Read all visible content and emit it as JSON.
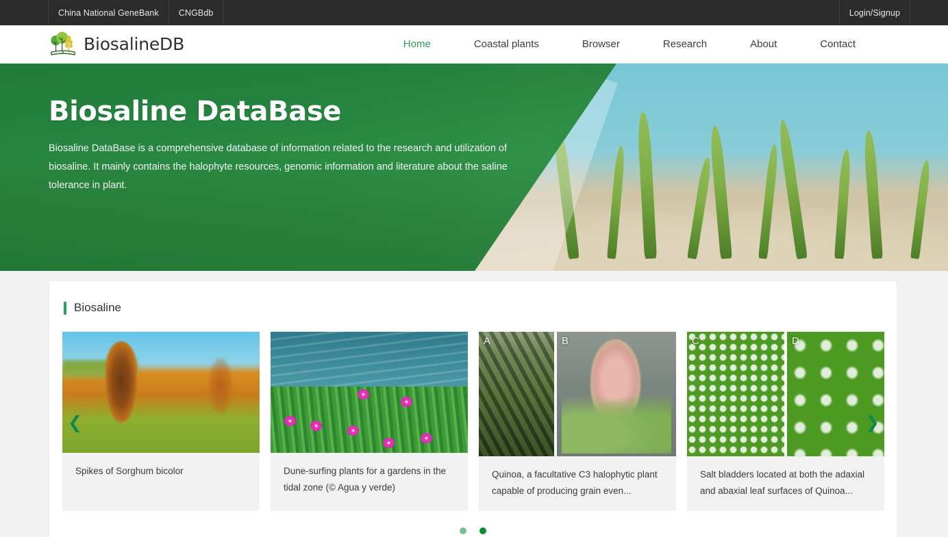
{
  "topbar": {
    "items": [
      {
        "label": "China National GeneBank"
      },
      {
        "label": "CNGBdb"
      }
    ],
    "login": "Login/Signup"
  },
  "header": {
    "brand": "BiosalineDB",
    "logo_icon": "tree-book-logo-icon",
    "nav": [
      {
        "label": "Home",
        "active": true
      },
      {
        "label": "Coastal plants",
        "active": false
      },
      {
        "label": "Browser",
        "active": false
      },
      {
        "label": "Research",
        "active": false
      },
      {
        "label": "About",
        "active": false
      },
      {
        "label": "Contact",
        "active": false
      }
    ]
  },
  "hero": {
    "title": "Biosaline DataBase",
    "description": "Biosaline DataBase is a comprehensive database of information related to the research and utilization of biosaline. It mainly contains the halophyte resources, genomic information and literature about the saline tolerance in plant."
  },
  "section": {
    "title": "Biosaline",
    "accent_color": "#2aa356"
  },
  "carousel": {
    "prev_icon": "chevron-left-icon",
    "next_icon": "chevron-right-icon",
    "cards": [
      {
        "image_alt": "sorghum-field-photo",
        "caption": "Spikes of Sorghum bicolor",
        "panel_labels": []
      },
      {
        "image_alt": "ice-plant-coastal-photo",
        "caption": "Dune-surfing plants for a gardens in the tidal zone (© Agua y verde)",
        "panel_labels": []
      },
      {
        "image_alt": "quinoa-plant-photo",
        "caption": "Quinoa, a facultative C3 halophytic plant capable of producing grain even...",
        "panel_labels": [
          "A",
          "B"
        ]
      },
      {
        "image_alt": "salt-bladder-leaf-surface-photo",
        "caption": "Salt bladders located at both the adaxial and abaxial leaf surfaces of Quinoa...",
        "panel_labels": [
          "C",
          "D"
        ]
      }
    ],
    "dots": [
      {
        "active": false
      },
      {
        "active": true
      }
    ]
  }
}
